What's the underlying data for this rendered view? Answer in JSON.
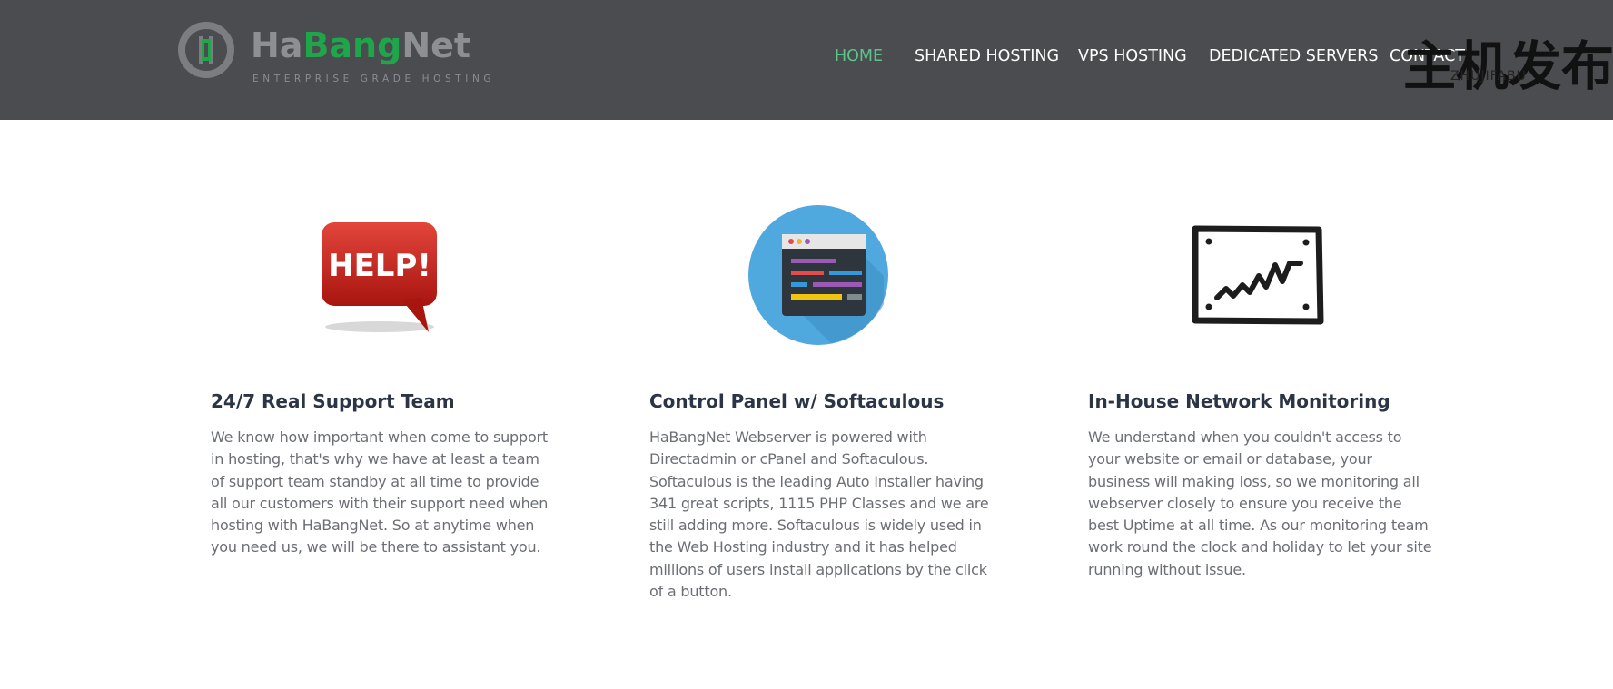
{
  "brand": {
    "name_part1": "Ha",
    "name_part2": "Bang",
    "name_part3": "Net",
    "tagline": "ENTERPRISE GRADE HOSTING",
    "colors": {
      "gray": "#8e8f92",
      "green": "#1fa64a"
    }
  },
  "nav": {
    "items": [
      {
        "label": "HOME",
        "active": true
      },
      {
        "label": "SHARED HOSTING",
        "active": false
      },
      {
        "label": "VPS HOSTING",
        "active": false
      },
      {
        "label": "DEDICATED SERVERS",
        "active": false
      },
      {
        "label": "CONTACT",
        "active": false
      }
    ],
    "active_color": "#5cc38a"
  },
  "watermark": {
    "cn": "主机发布",
    "en": "ZHUJIFABU"
  },
  "features": [
    {
      "icon": "help-bubble-icon",
      "icon_text": "HELP!",
      "title": "24/7 Real Support Team",
      "body": "We know how important when come to support in hosting, that's why we have at least a team of support team standby at all time to provide all our customers with their support need when hosting with HaBangNet. So at anytime when you need us, we will be there to assistant you."
    },
    {
      "icon": "control-panel-icon",
      "title": "Control Panel w/ Softaculous",
      "body": "HaBangNet Webserver is powered with Directadmin or cPanel and Softaculous. Softaculous is the leading Auto Installer having 341 great scripts, 1115 PHP Classes and we are still adding more. Softaculous is widely used in the Web Hosting industry and it has helped millions of users install applications by the click of a button."
    },
    {
      "icon": "monitoring-chart-icon",
      "title": "In-House Network Monitoring",
      "body": "We understand when you couldn't access to your website or email or database, your business will making loss, so we monitoring all webserver closely to ensure you receive the best Uptime at all time. As our monitoring team work round the clock and holiday to let your site running without issue."
    }
  ]
}
